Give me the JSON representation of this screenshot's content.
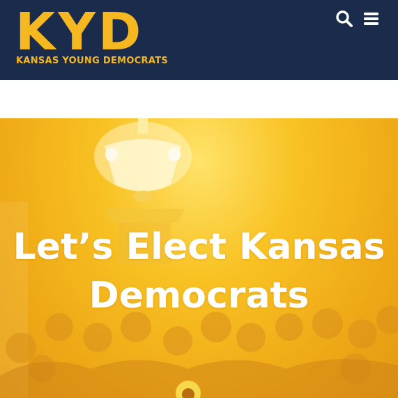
{
  "header": {
    "logo_letters": "KYD",
    "logo_subtitle": "KANSAS YOUNG DEMOCRATS",
    "background_color": "#1a2b4c",
    "accent_color": "#f5b820",
    "icons": [
      "search-icon",
      "menu-icon"
    ]
  },
  "hero": {
    "title_line1": "Let’s Elect Kansas",
    "title_line2": "Democrats",
    "overlay_color": "#f7b91e",
    "image_content": "group photo of young democrats under a chandelier"
  }
}
